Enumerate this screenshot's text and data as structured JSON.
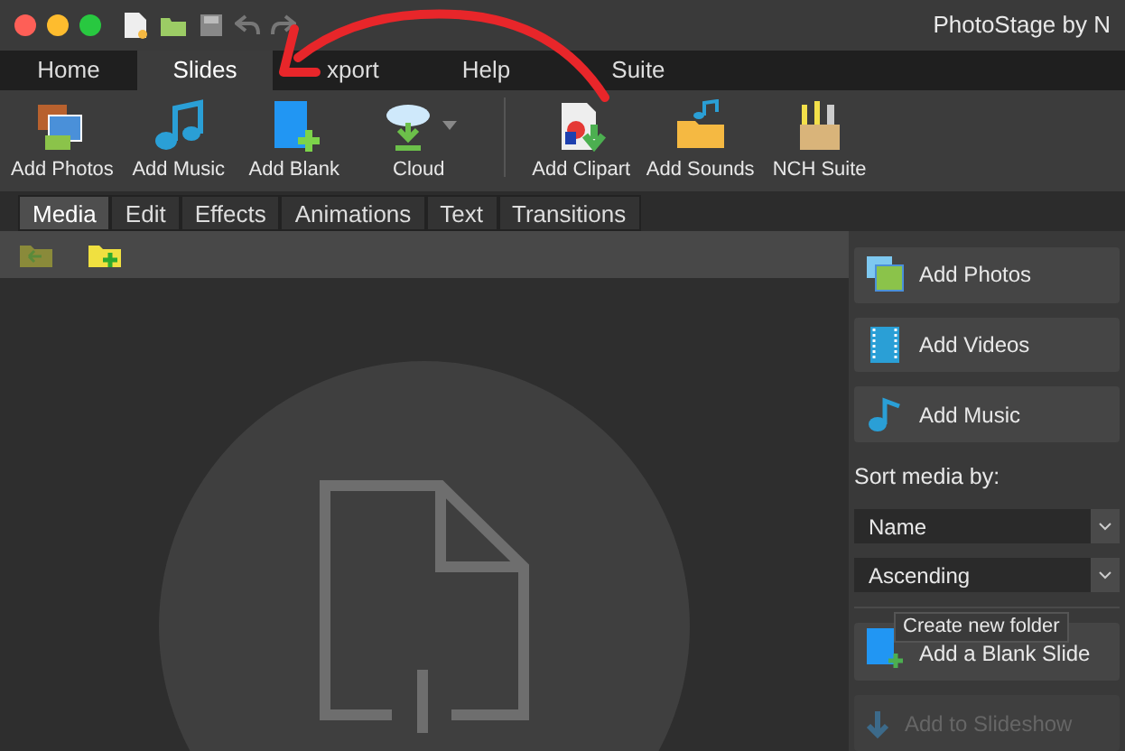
{
  "window": {
    "title": "PhotoStage by N"
  },
  "ribbon_tabs": [
    {
      "label": "Home",
      "selected": false
    },
    {
      "label": "Slides",
      "selected": true
    },
    {
      "label": "xport",
      "selected": false
    },
    {
      "label": "Help",
      "selected": false
    },
    {
      "label": "Suite",
      "selected": false
    }
  ],
  "toolbar": [
    "Add Photos",
    "Add Music",
    "Add Blank",
    "Cloud",
    "Add Clipart",
    "Add Sounds",
    "NCH Suite"
  ],
  "sub_tabs": [
    {
      "label": "Media",
      "selected": true
    },
    {
      "label": "Edit",
      "selected": false
    },
    {
      "label": "Effects",
      "selected": false
    },
    {
      "label": "Animations",
      "selected": false
    },
    {
      "label": "Text",
      "selected": false
    },
    {
      "label": "Transitions",
      "selected": false
    }
  ],
  "media_panel": {
    "buttons": [
      "Add Photos",
      "Add Videos",
      "Add Music"
    ],
    "sort_label": "Sort media by:",
    "sort_field": "Name",
    "sort_order": "Ascending",
    "add_blank": "Add a Blank Slide",
    "tooltip": "Create new folder",
    "add_to_slideshow": {
      "label": "Add to Slideshow",
      "disabled": true
    }
  }
}
